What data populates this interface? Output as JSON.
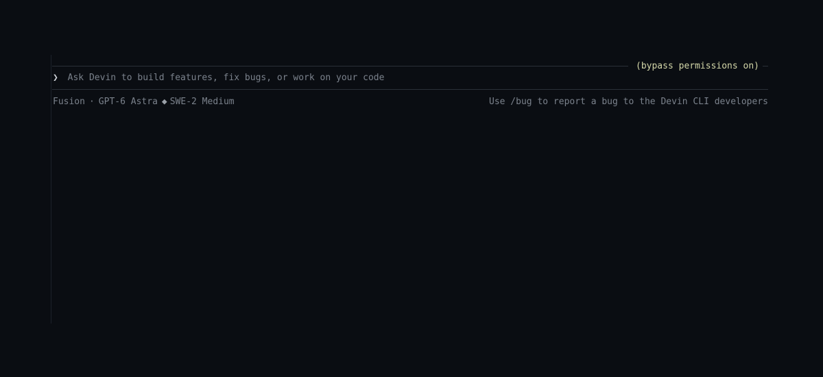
{
  "header": {
    "mode_label": "(bypass permissions on)"
  },
  "prompt": {
    "chevron": "❯",
    "placeholder": "Ask Devin to build features, fix bugs, or work on your code"
  },
  "status": {
    "agent": "Fusion",
    "separator": "·",
    "model": "GPT-6 Astra",
    "diamond": "◆",
    "effort": "SWE-2 Medium",
    "hint": "Use /bug to report a bug to the Devin CLI developers"
  }
}
